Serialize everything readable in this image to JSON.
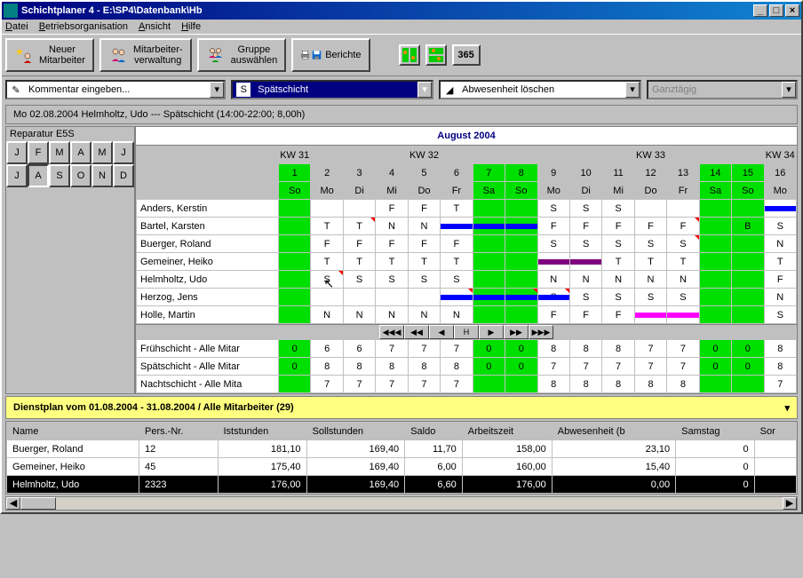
{
  "window": {
    "title": "Schichtplaner 4 - E:\\SP4\\Datenbank\\Hb"
  },
  "menu": {
    "datei": "Datei",
    "betrieb": "Betriebsorganisation",
    "ansicht": "Ansicht",
    "hilfe": "Hilfe"
  },
  "toolbar": {
    "neuer": "Neuer\nMitarbeiter",
    "verwaltung": "Mitarbeiter-\nverwaltung",
    "gruppe": "Gruppe\nauswählen",
    "berichte": "Berichte",
    "cal365": "365"
  },
  "combos": {
    "kommentar": "Kommentar eingeben...",
    "shift_badge": "S",
    "shift_label": "Spätschicht",
    "abwesen": "Abwesenheit löschen",
    "ganztag": "Ganztägig"
  },
  "statusline": "Mo 02.08.2004 Helmholtz, Udo --- Spätschicht (14:00-22:00; 8,00h)",
  "monthsel": {
    "label": "Reparatur E5S",
    "months": [
      "J",
      "F",
      "M",
      "A",
      "M",
      "J",
      "J",
      "A",
      "S",
      "O",
      "N",
      "D"
    ],
    "selected": 7
  },
  "grid": {
    "title": "August 2004",
    "kw": [
      "KW 31",
      "KW 32",
      "KW 33",
      "KW 34"
    ],
    "days": [
      {
        "n": "1",
        "d": "So",
        "w": true
      },
      {
        "n": "2",
        "d": "Mo",
        "w": false
      },
      {
        "n": "3",
        "d": "Di",
        "w": false
      },
      {
        "n": "4",
        "d": "Mi",
        "w": false
      },
      {
        "n": "5",
        "d": "Do",
        "w": false
      },
      {
        "n": "6",
        "d": "Fr",
        "w": false
      },
      {
        "n": "7",
        "d": "Sa",
        "w": true
      },
      {
        "n": "8",
        "d": "So",
        "w": true
      },
      {
        "n": "9",
        "d": "Mo",
        "w": false
      },
      {
        "n": "10",
        "d": "Di",
        "w": false
      },
      {
        "n": "11",
        "d": "Mi",
        "w": false
      },
      {
        "n": "12",
        "d": "Do",
        "w": false
      },
      {
        "n": "13",
        "d": "Fr",
        "w": false
      },
      {
        "n": "14",
        "d": "Sa",
        "w": true
      },
      {
        "n": "15",
        "d": "So",
        "w": true
      },
      {
        "n": "16",
        "d": "Mo",
        "w": false
      }
    ],
    "rows": [
      {
        "name": "Anders, Kerstin",
        "cells": [
          "",
          "",
          "",
          "F",
          "F",
          "T",
          "",
          "",
          "S",
          "S",
          "S",
          "",
          "",
          "",
          "",
          ""
        ]
      },
      {
        "name": "Bartel, Karsten",
        "cells": [
          "",
          "T",
          "T",
          "N",
          "N",
          "",
          "",
          "",
          "F",
          "F",
          "F",
          "F",
          "F",
          "",
          "B",
          "S"
        ]
      },
      {
        "name": "Buerger, Roland",
        "cells": [
          "",
          "F",
          "F",
          "F",
          "F",
          "F",
          "",
          "",
          "S",
          "S",
          "S",
          "S",
          "S",
          "",
          "",
          "N"
        ]
      },
      {
        "name": "Gemeiner, Heiko",
        "cells": [
          "",
          "T",
          "T",
          "T",
          "T",
          "T",
          "",
          "",
          "",
          "",
          "T",
          "T",
          "T",
          "",
          "",
          "T"
        ]
      },
      {
        "name": "Helmholtz, Udo",
        "cells": [
          "",
          "S",
          "S",
          "S",
          "S",
          "S",
          "",
          "",
          "N",
          "N",
          "N",
          "N",
          "N",
          "",
          "",
          "F"
        ]
      },
      {
        "name": "Herzog, Jens",
        "cells": [
          "",
          "",
          "",
          "",
          "",
          "",
          "",
          "",
          "S",
          "S",
          "S",
          "S",
          "S",
          "",
          "",
          "N"
        ]
      },
      {
        "name": "Holle, Martin",
        "cells": [
          "",
          "N",
          "N",
          "N",
          "N",
          "N",
          "",
          "",
          "F",
          "F",
          "F",
          "",
          "",
          "",
          "",
          "S"
        ]
      }
    ],
    "stats": [
      {
        "name": "Frühschicht - Alle Mitar",
        "v": [
          "0",
          "6",
          "6",
          "7",
          "7",
          "7",
          "0",
          "0",
          "8",
          "8",
          "8",
          "7",
          "7",
          "0",
          "0",
          "8"
        ]
      },
      {
        "name": "Spätschicht - Alle Mitar",
        "v": [
          "0",
          "8",
          "8",
          "8",
          "8",
          "8",
          "0",
          "0",
          "7",
          "7",
          "7",
          "7",
          "7",
          "0",
          "0",
          "8"
        ]
      },
      {
        "name": "Nachtschicht - Alle Mita",
        "v": [
          "",
          "7",
          "7",
          "7",
          "7",
          "7",
          "",
          "",
          "8",
          "8",
          "8",
          "8",
          "8",
          "",
          "",
          "7"
        ]
      }
    ]
  },
  "summary": {
    "title": "Dienstplan vom 01.08.2004 - 31.08.2004 / Alle Mitarbeiter (29)",
    "cols": [
      "Name",
      "Pers.-Nr.",
      "Iststunden",
      "Sollstunden",
      "Saldo",
      "Arbeitszeit",
      "Abwesenheit (b",
      "Samstag",
      "Sor"
    ],
    "rows": [
      {
        "sel": false,
        "c": [
          "Buerger, Roland",
          "12",
          "181,10",
          "169,40",
          "11,70",
          "158,00",
          "23,10",
          "0",
          ""
        ]
      },
      {
        "sel": false,
        "c": [
          "Gemeiner, Heiko",
          "45",
          "175,40",
          "169,40",
          "6,00",
          "160,00",
          "15,40",
          "0",
          ""
        ]
      },
      {
        "sel": true,
        "c": [
          "Helmholtz, Udo",
          "2323",
          "176,00",
          "169,40",
          "6,60",
          "176,00",
          "0,00",
          "0",
          ""
        ]
      }
    ]
  },
  "nav": [
    "⏮",
    "◀◀",
    "◀",
    "H",
    "▶",
    "▶▶",
    "⏭"
  ]
}
